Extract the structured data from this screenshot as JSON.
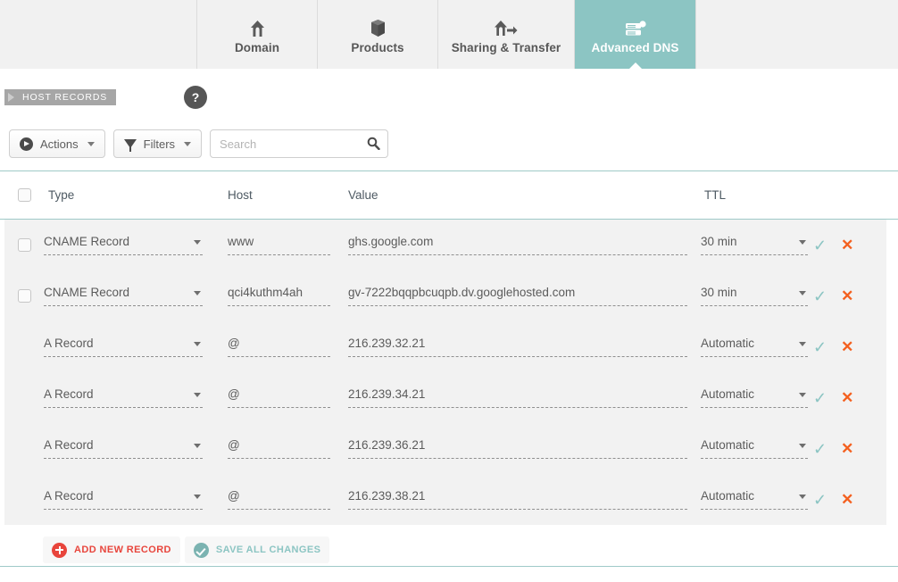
{
  "tabs": [
    {
      "label": "Domain",
      "icon": "home-icon",
      "active": false
    },
    {
      "label": "Products",
      "icon": "box-icon",
      "active": false
    },
    {
      "label": "Sharing & Transfer",
      "icon": "home-arrow-icon",
      "active": false
    },
    {
      "label": "Advanced DNS",
      "icon": "server-icon",
      "active": true
    }
  ],
  "section": {
    "badge": "HOST RECORDS",
    "help_label": "?"
  },
  "toolbar": {
    "actions_label": "Actions",
    "filters_label": "Filters",
    "search_placeholder": "Search",
    "search_value": ""
  },
  "table": {
    "headers": {
      "type": "Type",
      "host": "Host",
      "value": "Value",
      "ttl": "TTL"
    },
    "rows": [
      {
        "checkbox": true,
        "type": "CNAME Record",
        "host": "www",
        "value": "ghs.google.com",
        "ttl": "30 min",
        "confirm": "✓",
        "delete": "✕"
      },
      {
        "checkbox": true,
        "type": "CNAME Record",
        "host": "qci4kuthm4ah",
        "value": "gv-7222bqqpbcuqpb.dv.googlehosted.com",
        "ttl": "30 min",
        "confirm": "✓",
        "delete": "✕"
      },
      {
        "checkbox": false,
        "type": "A Record",
        "host": "@",
        "value": "216.239.32.21",
        "ttl": "Automatic",
        "confirm": "✓",
        "delete": "✕"
      },
      {
        "checkbox": false,
        "type": "A Record",
        "host": "@",
        "value": "216.239.34.21",
        "ttl": "Automatic",
        "confirm": "✓",
        "delete": "✕"
      },
      {
        "checkbox": false,
        "type": "A Record",
        "host": "@",
        "value": "216.239.36.21",
        "ttl": "Automatic",
        "confirm": "✓",
        "delete": "✕"
      },
      {
        "checkbox": false,
        "type": "A Record",
        "host": "@",
        "value": "216.239.38.21",
        "ttl": "Automatic",
        "confirm": "✓",
        "delete": "✕"
      }
    ]
  },
  "footer": {
    "add_label": "ADD NEW RECORD",
    "save_label": "SAVE ALL CHANGES"
  },
  "colors": {
    "accent_teal": "#8cc5c3",
    "delete_orange": "#f4601f",
    "add_red": "#e8453c",
    "badge_gray": "#a6a6a6",
    "row_gray": "#f2f2f2"
  }
}
